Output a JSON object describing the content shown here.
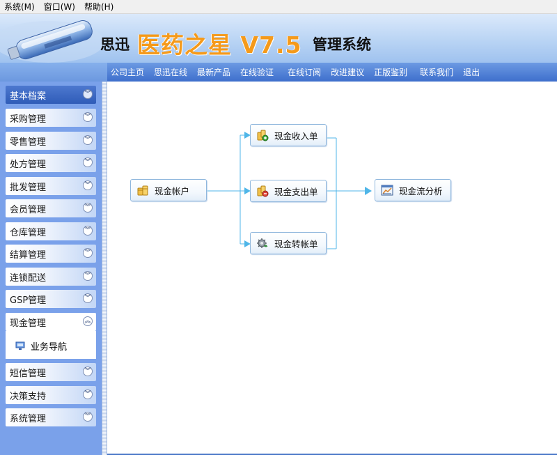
{
  "menubar": {
    "items": [
      "系统(M)",
      "窗口(W)",
      "帮助(H)"
    ]
  },
  "banner": {
    "prefix": "思迅",
    "brand": "医药之星 V7.5",
    "suffix": "管理系统"
  },
  "nav": {
    "links": [
      "公司主页",
      "思迅在线",
      "最新产品",
      "在线验证",
      "在线订阅",
      "改进建议",
      "正版鉴别",
      "联系我们",
      "退出"
    ]
  },
  "sidebar": {
    "items": [
      {
        "label": "基本档案",
        "state": "active"
      },
      {
        "label": "采购管理",
        "state": "collapsed"
      },
      {
        "label": "零售管理",
        "state": "collapsed"
      },
      {
        "label": "处方管理",
        "state": "collapsed"
      },
      {
        "label": "批发管理",
        "state": "collapsed"
      },
      {
        "label": "会员管理",
        "state": "collapsed"
      },
      {
        "label": "仓库管理",
        "state": "collapsed"
      },
      {
        "label": "结算管理",
        "state": "collapsed"
      },
      {
        "label": "连锁配送",
        "state": "collapsed"
      },
      {
        "label": "GSP管理",
        "state": "collapsed"
      },
      {
        "label": "现金管理",
        "state": "expanded"
      },
      {
        "label": "短信管理",
        "state": "collapsed"
      },
      {
        "label": "决策支持",
        "state": "collapsed"
      },
      {
        "label": "系统管理",
        "state": "collapsed"
      }
    ],
    "subitems": [
      {
        "label": "业务导航",
        "icon": "monitor-icon"
      }
    ]
  },
  "flow": {
    "nodes": {
      "cash_account": {
        "label": "现金帐户",
        "icon": "coins-icon"
      },
      "cash_receipt": {
        "label": "现金收入单",
        "icon": "coins-add-icon"
      },
      "cash_payment": {
        "label": "现金支出单",
        "icon": "coins-remove-icon"
      },
      "cash_transfer": {
        "label": "现金转帐单",
        "icon": "transfer-gear-icon"
      },
      "cashflow_analysis": {
        "label": "现金流分析",
        "icon": "chart-window-icon"
      }
    }
  },
  "colors": {
    "nav_bar": "#3e6fcc",
    "sidebar_bg": "#7aa1ea",
    "brand_orange": "#f59a1b",
    "active_item": "#2f5cb8",
    "connector": "#4fb6e8"
  }
}
